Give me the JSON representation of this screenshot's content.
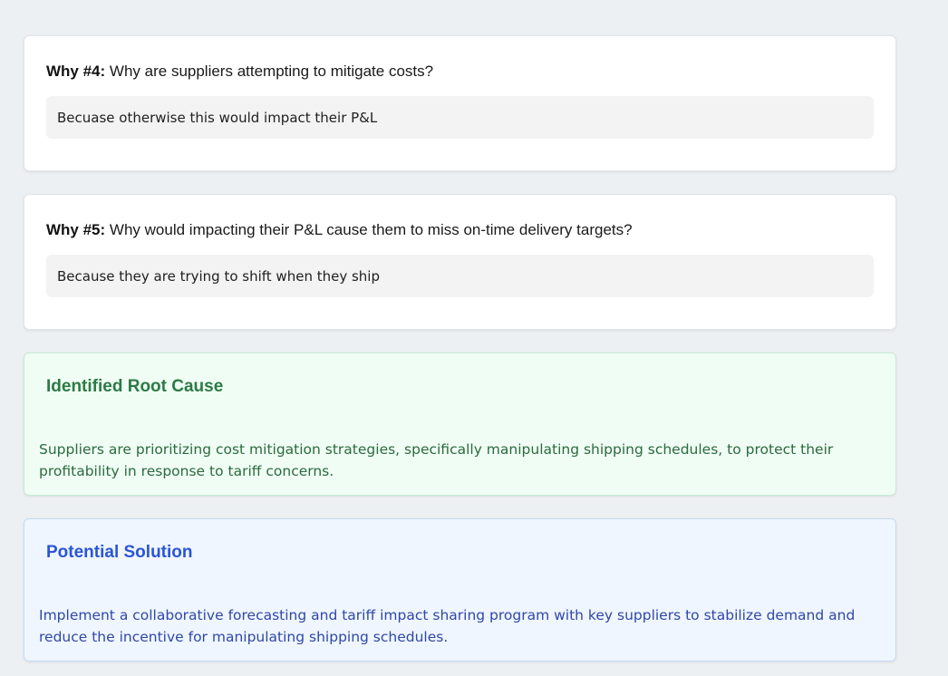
{
  "whys": [
    {
      "number_label": "Why #4:",
      "question": "Why are suppliers attempting to mitigate costs?",
      "answer": "Becuase otherwise this would impact their P&L"
    },
    {
      "number_label": "Why #5:",
      "question": "Why would impacting their P&L cause them to miss on-time delivery targets?",
      "answer": "Because they are trying to shift when they ship"
    }
  ],
  "root_cause": {
    "title": "Identified Root Cause",
    "body": "Suppliers are prioritizing cost mitigation strategies, specifically manipulating shipping schedules, to protect their profitability in response to tariff concerns."
  },
  "solution": {
    "title": "Potential Solution",
    "body": "Implement a collaborative forecasting and tariff impact sharing program with key suppliers to stabilize demand and reduce the incentive for manipulating shipping schedules."
  },
  "colors": {
    "page_bg": "#edf0f3",
    "root_bg": "#f0fdf4",
    "root_title": "#2c7a45",
    "solution_bg": "#eff6ff",
    "solution_title": "#2a55d6"
  }
}
